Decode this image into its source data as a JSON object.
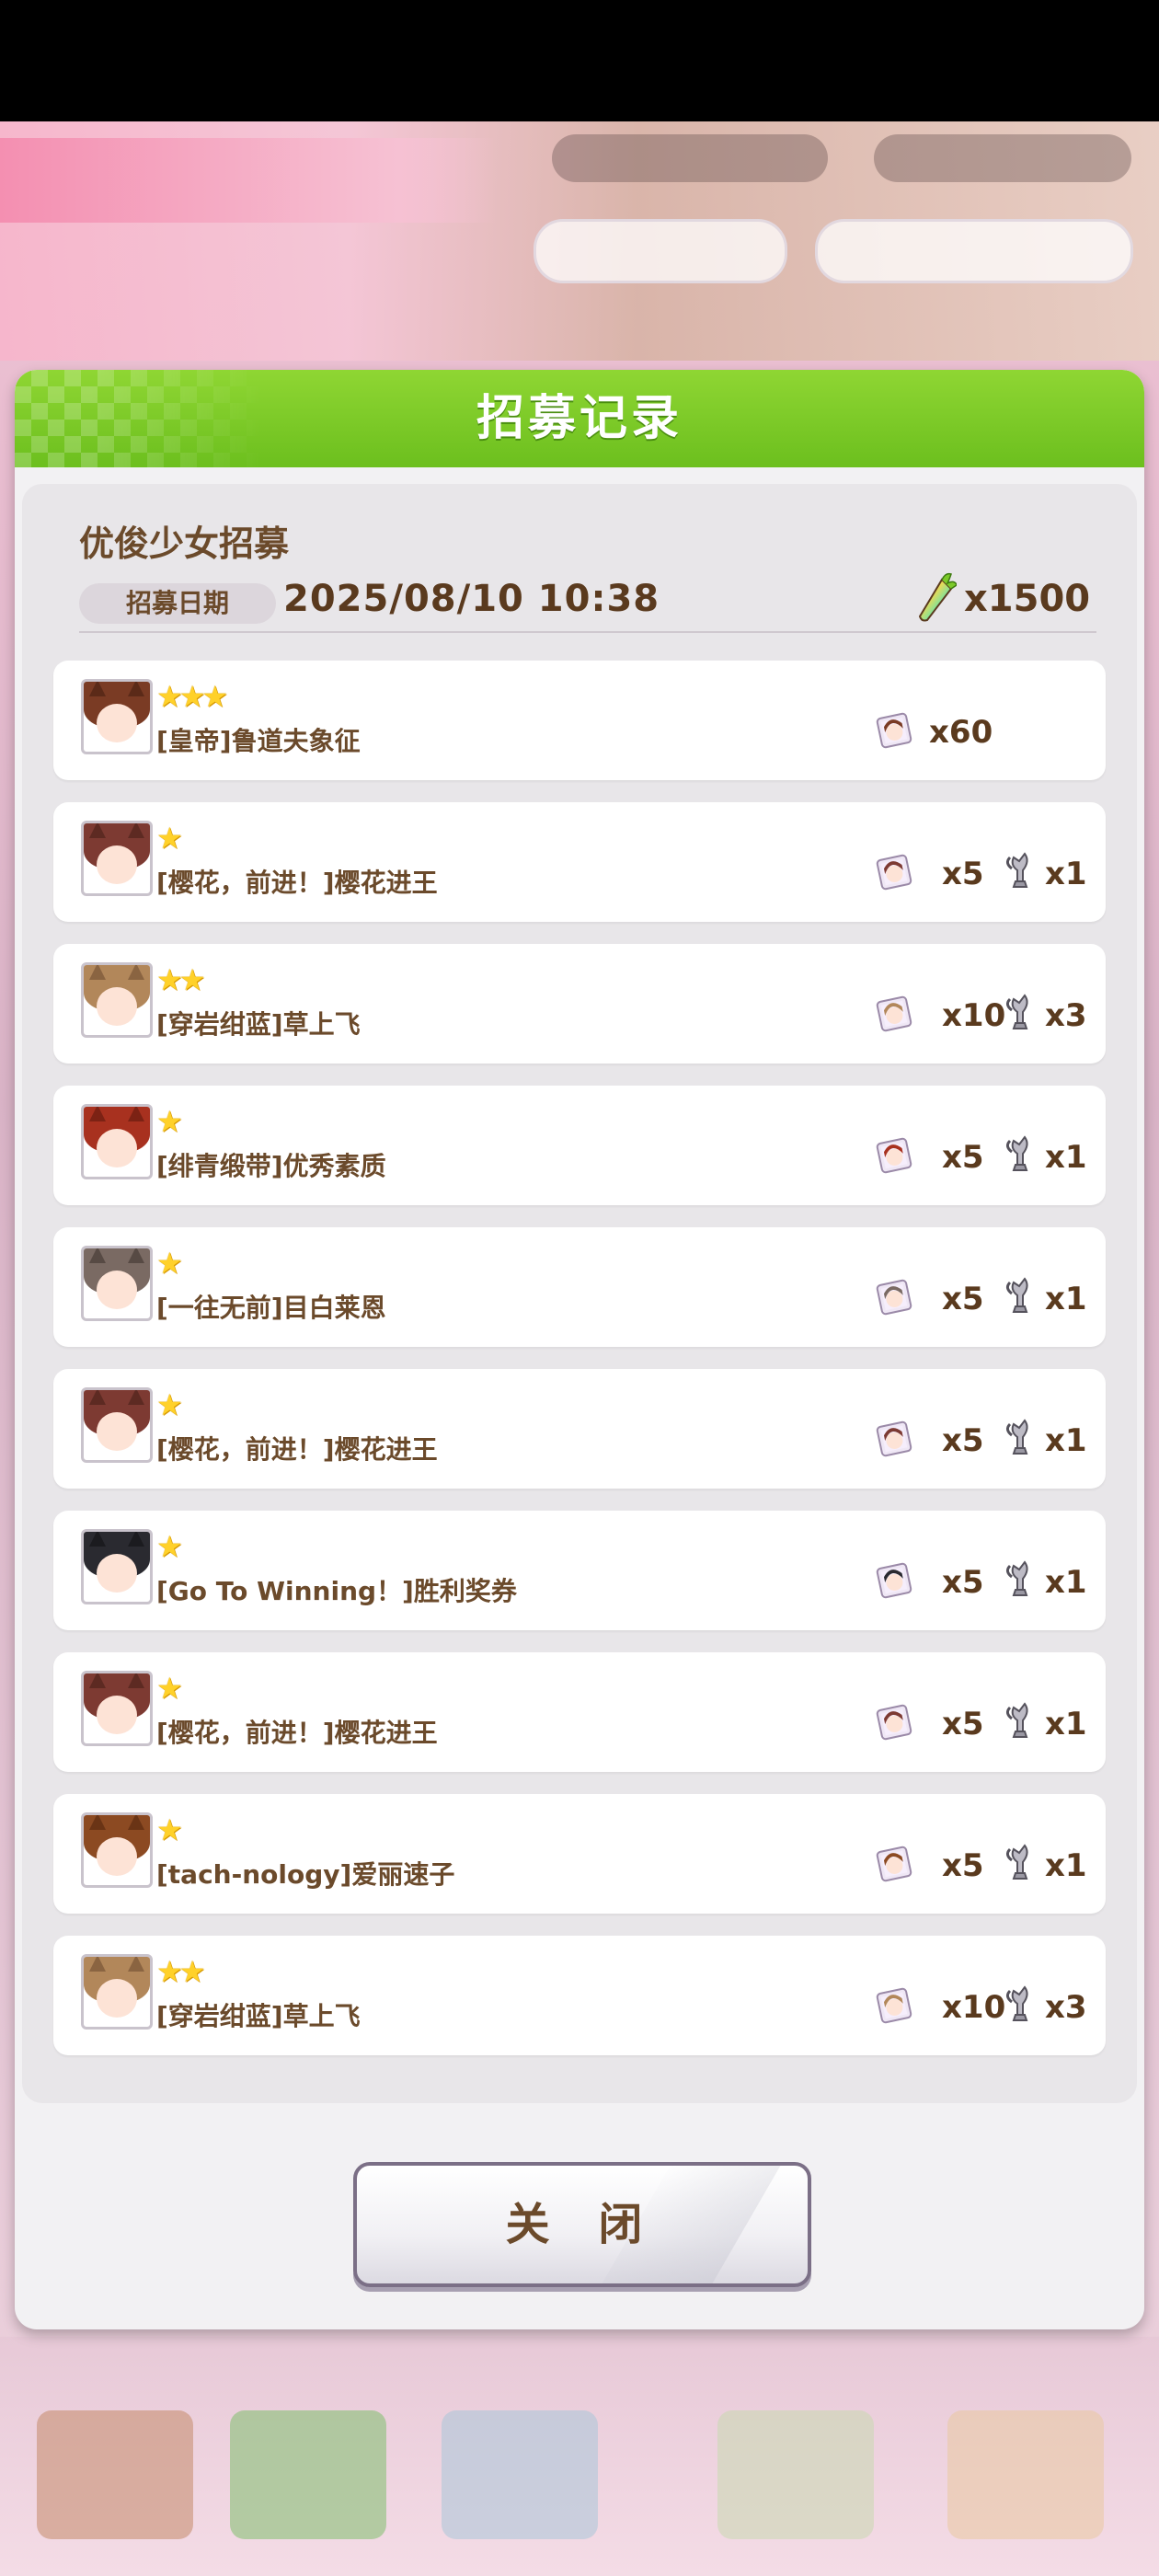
{
  "dialog": {
    "title": "招募记录",
    "gacha_name": "优俊少女招募",
    "date_label": "招募日期",
    "date_value": "2025/08/10  10:38",
    "cost": "x1500",
    "cost_icon": "carat-icon",
    "close_label": "关 闭"
  },
  "colors": {
    "header_green": "#7cc92a",
    "text_brown": "#6b4a2b",
    "star_gold": "#ffd12a"
  },
  "results": [
    {
      "stars": "★★★",
      "name": "[皇帝]鲁道夫象征",
      "reward1": "x60",
      "reward2": "",
      "hair": "#7a3b24",
      "ear": "#5b2a18"
    },
    {
      "stars": "★",
      "name": "[樱花，前进！]樱花进王",
      "reward1": "x5",
      "reward2": "x1",
      "hair": "#7d3a32",
      "ear": "#5d2a22"
    },
    {
      "stars": "★★",
      "name": "[穿岩绀蓝]草上飞",
      "reward1": "x10",
      "reward2": "x3",
      "hair": "#b2875a",
      "ear": "#8a6441"
    },
    {
      "stars": "★",
      "name": "[绯青缎带]优秀素质",
      "reward1": "x5",
      "reward2": "x1",
      "hair": "#a8311f",
      "ear": "#7c2214"
    },
    {
      "stars": "★",
      "name": "[一往无前]目白莱恩",
      "reward1": "x5",
      "reward2": "x1",
      "hair": "#7a6a63",
      "ear": "#574a44"
    },
    {
      "stars": "★",
      "name": "[樱花，前进！]樱花进王",
      "reward1": "x5",
      "reward2": "x1",
      "hair": "#7d3a32",
      "ear": "#5d2a22"
    },
    {
      "stars": "★",
      "name": "[Go To Winning！]胜利奖券",
      "reward1": "x5",
      "reward2": "x1",
      "hair": "#2a2a30",
      "ear": "#1b1b1f"
    },
    {
      "stars": "★",
      "name": "[樱花，前进！]樱花进王",
      "reward1": "x5",
      "reward2": "x1",
      "hair": "#7d3a32",
      "ear": "#5d2a22"
    },
    {
      "stars": "★",
      "name": "[tach-nology]爱丽速子",
      "reward1": "x5",
      "reward2": "x1",
      "hair": "#8c4a22",
      "ear": "#6a3415"
    },
    {
      "stars": "★★",
      "name": "[穿岩绀蓝]草上飞",
      "reward1": "x10",
      "reward2": "x3",
      "hair": "#b2875a",
      "ear": "#8a6441"
    }
  ],
  "icons": {
    "reward1": "character-piece-icon",
    "reward2": "memorial-trophy-icon"
  }
}
